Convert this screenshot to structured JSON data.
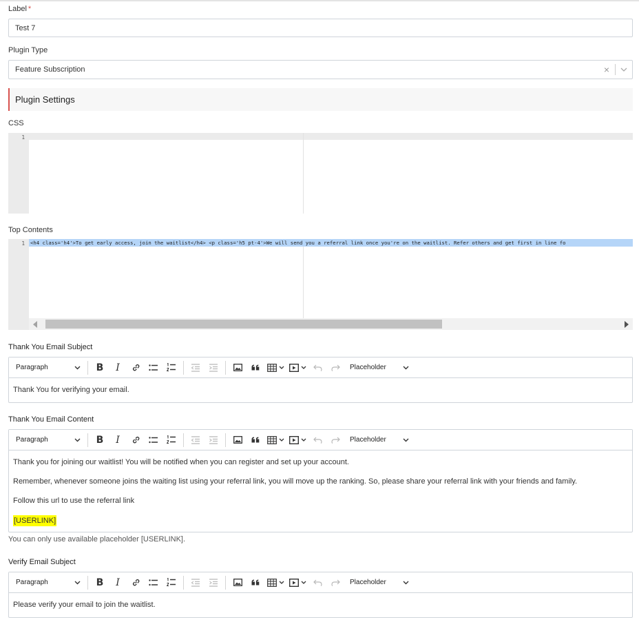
{
  "fields": {
    "label": {
      "label": "Label",
      "required_mark": "*",
      "value": "Test 7"
    },
    "plugin_type": {
      "label": "Plugin Type",
      "value": "Feature Subscription",
      "clear_icon": "×",
      "dropdown_icon": "chevron-down"
    }
  },
  "section": {
    "title": "Plugin Settings"
  },
  "css": {
    "label": "CSS",
    "line_number": "1",
    "code": ""
  },
  "top_contents": {
    "label": "Top Contents",
    "line_number": "1",
    "code": "<h4 class='h4'>To get early access, join the waitlist</h4> <p class='h5 pt-4'>We will send you a referral link once you're on the waitlist. Refer others and get first in line fo"
  },
  "toolbar": {
    "block_format": "Paragraph",
    "placeholder_label": "Placeholder",
    "icons": [
      "bold-icon",
      "italic-icon",
      "link-icon",
      "bullet-list-icon",
      "numbered-list-icon",
      "outdent-icon",
      "indent-icon",
      "image-icon",
      "blockquote-icon",
      "table-icon",
      "media-icon",
      "undo-icon",
      "redo-icon"
    ]
  },
  "thank_you_subject": {
    "label": "Thank You Email Subject",
    "content": "Thank You for verifying your email."
  },
  "thank_you_content": {
    "label": "Thank You Email Content",
    "paragraphs": [
      "Thank you for joining our waitlist! You will be notified when you can register and set up your account.",
      "Remember, whenever someone joins the waiting list using your referral link, you will move up the ranking. So, please share your referral link with your friends and family.",
      "Follow this url to use the referral link",
      "[USERLINK]"
    ],
    "help": "You can only use available placeholder [USERLINK]."
  },
  "verify_subject": {
    "label": "Verify Email Subject",
    "content": "Please verify your email to join the waitlist."
  },
  "colors": {
    "required": "#d9534f",
    "accent": "#d9534f",
    "selection": "#b5d5f8",
    "highlight": "#ffff00"
  }
}
